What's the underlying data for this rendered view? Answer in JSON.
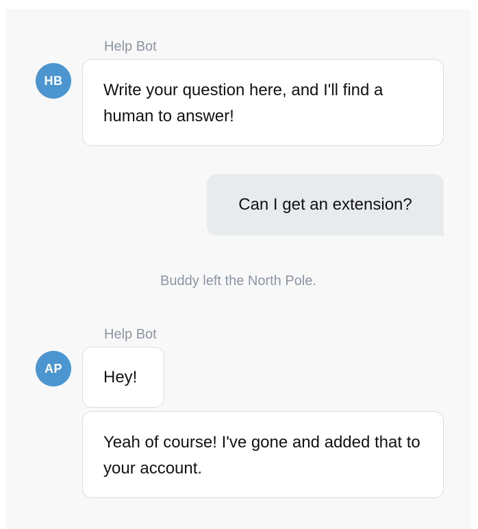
{
  "messages": [
    {
      "type": "bot",
      "sender": "Help Bot",
      "avatar_initials": "HB",
      "texts": [
        "Write your question here, and I'll find a human to answer!"
      ]
    },
    {
      "type": "user",
      "texts": [
        "Can I get an extension?"
      ]
    },
    {
      "type": "system",
      "text": "Buddy left the North Pole."
    },
    {
      "type": "bot",
      "sender": "Help Bot",
      "avatar_initials": "AP",
      "texts": [
        "Hey!",
        "Yeah of course! I've gone and added that to your account."
      ]
    }
  ],
  "colors": {
    "avatar": "#4b95d1",
    "user_bubble": "#e8ebee",
    "bot_bubble": "#ffffff",
    "muted_text": "#8a95a0",
    "panel_background": "#f8f8f8"
  }
}
